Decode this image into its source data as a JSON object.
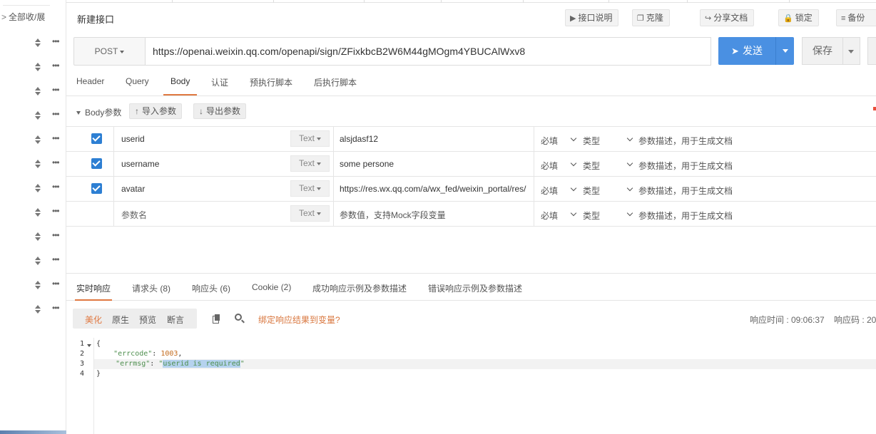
{
  "sidebar": {
    "collapse_label": "全部收/展",
    "rows": 12
  },
  "header": {
    "title": "新建接口",
    "buttons": [
      {
        "icon": "play-icon",
        "label": "接口说明"
      },
      {
        "icon": "clone-icon",
        "label": "克隆"
      },
      {
        "icon": "share-icon",
        "label": "分享文档"
      },
      {
        "icon": "lock-icon",
        "label": "锁定"
      },
      {
        "icon": "database-icon",
        "label": "备份"
      }
    ]
  },
  "request": {
    "method": "POST",
    "url": "https://openai.weixin.qq.com/openapi/sign/ZFixkbcB2W6M44gMOgm4YBUCAlWxv8",
    "send_label": "发送",
    "save_label": "保存"
  },
  "request_tabs": [
    {
      "label": "Header",
      "active": false
    },
    {
      "label": "Query",
      "active": false
    },
    {
      "label": "Body",
      "active": true
    },
    {
      "label": "认证",
      "active": false
    },
    {
      "label": "预执行脚本",
      "active": false
    },
    {
      "label": "后执行脚本",
      "active": false
    }
  ],
  "body_params": {
    "label": "Body参数",
    "import_label": "导入参数",
    "export_label": "导出参数",
    "rows": [
      {
        "checked": true,
        "name": "userid",
        "type": "Text",
        "value": "alsjdasf12",
        "required": "必填",
        "kind": "类型",
        "desc": "参数描述，用于生成文档"
      },
      {
        "checked": true,
        "name": "username",
        "type": "Text",
        "value": "some persone",
        "required": "必填",
        "kind": "类型",
        "desc": "参数描述，用于生成文档"
      },
      {
        "checked": true,
        "name": "avatar",
        "type": "Text",
        "value": "https://res.wx.qq.com/a/wx_fed/weixin_portal/res/",
        "required": "必填",
        "kind": "类型",
        "desc": "参数描述，用于生成文档"
      },
      {
        "checked": false,
        "name": "参数名",
        "type": "Text",
        "value": "参数值，支持Mock字段变量",
        "required": "必填",
        "kind": "类型",
        "desc": "参数描述，用于生成文档"
      }
    ]
  },
  "response_tabs": [
    {
      "label": "实时响应",
      "active": true
    },
    {
      "label": "请求头 (8)",
      "active": false
    },
    {
      "label": "响应头 (6)",
      "active": false
    },
    {
      "label": "Cookie (2)",
      "active": false
    },
    {
      "label": "成功响应示例及参数描述",
      "active": false
    },
    {
      "label": "错误响应示例及参数描述",
      "active": false
    }
  ],
  "response_toolbar": {
    "formats": [
      {
        "label": "美化",
        "active": true
      },
      {
        "label": "原生",
        "active": false
      },
      {
        "label": "预览",
        "active": false
      },
      {
        "label": "断言",
        "active": false
      }
    ],
    "bind_link": "绑定响应结果到变量?",
    "time_label": "响应时间 : 09:06:37",
    "code_label": "响应码 : 20"
  },
  "response_body": {
    "line_numbers": [
      "1",
      "2",
      "3",
      "4"
    ],
    "open_brace": "{",
    "close_brace": "}",
    "errcode_key": "\"errcode\"",
    "errcode_value": "1003",
    "errmsg_key": "\"errmsg\"",
    "errmsg_value": "userid is required"
  },
  "colors": {
    "accent": "#4a90e2",
    "active_tab": "#e07840",
    "checkbox": "#2d7fd3"
  }
}
